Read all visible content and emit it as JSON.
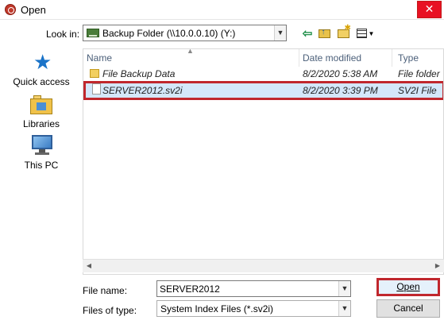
{
  "window": {
    "title": "Open",
    "close_glyph": "✕"
  },
  "toolbar": {
    "look_in_label": "Look in:",
    "look_in_value": "Backup Folder (\\\\10.0.0.10) (Y:)",
    "icons": [
      "back-arrow-icon",
      "up-folder-icon",
      "new-folder-icon",
      "view-menu-icon"
    ]
  },
  "places": [
    {
      "label": "Quick access",
      "icon": "star-icon"
    },
    {
      "label": "Libraries",
      "icon": "libraries-icon"
    },
    {
      "label": "This PC",
      "icon": "computer-icon"
    }
  ],
  "filelist": {
    "columns": [
      "Name",
      "Date modified",
      "Type"
    ],
    "rows": [
      {
        "name": "File Backup Data",
        "date": "8/2/2020 5:38 AM",
        "type": "File folder",
        "icon": "folder-icon",
        "selected": false
      },
      {
        "name": "SERVER2012.sv2i",
        "date": "8/2/2020 3:39 PM",
        "type": "SV2I File",
        "icon": "document-icon",
        "selected": true
      }
    ]
  },
  "form": {
    "file_name_label": "File name:",
    "file_name_value": "SERVER2012",
    "files_of_type_label": "Files of type:",
    "files_of_type_value": "System Index Files (*.sv2i)"
  },
  "buttons": {
    "open": "Open",
    "cancel": "Cancel"
  },
  "colors": {
    "highlight_border": "#c0272d",
    "selection_bg": "#d4e7fa",
    "header_text": "#4c607a"
  }
}
